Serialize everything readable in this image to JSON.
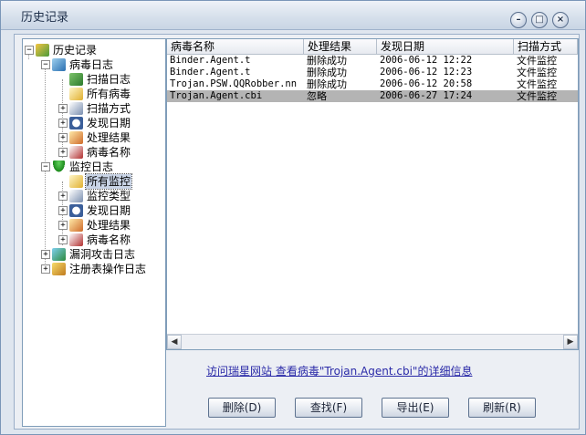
{
  "window": {
    "title": "历史记录"
  },
  "titlebar": {
    "minimize": "–",
    "maximize": "□",
    "close": "×"
  },
  "tree": {
    "root": "历史记录",
    "virus_log": "病毒日志",
    "virus_children": [
      "扫描日志",
      "所有病毒",
      "扫描方式",
      "发现日期",
      "处理结果",
      "病毒名称"
    ],
    "monitor_log": "监控日志",
    "monitor_children": [
      "所有监控",
      "监控类型",
      "发现日期",
      "处理结果",
      "病毒名称"
    ],
    "vuln_log": "漏洞攻击日志",
    "registry_log": "注册表操作日志"
  },
  "list": {
    "columns": [
      "病毒名称",
      "处理结果",
      "发现日期",
      "扫描方式"
    ],
    "rows": [
      [
        "Binder.Agent.t",
        "删除成功",
        "2006-06-12 12:22",
        "文件监控"
      ],
      [
        "Binder.Agent.t",
        "删除成功",
        "2006-06-12 12:23",
        "文件监控"
      ],
      [
        "Trojan.PSW.QQRobber.nn",
        "删除成功",
        "2006-06-12 20:58",
        "文件监控"
      ],
      [
        "Trojan.Agent.cbi",
        "忽略",
        "2006-06-27 17:24",
        "文件监控"
      ]
    ]
  },
  "links": {
    "visit": "访问瑞星网站",
    "details": "查看病毒\"Trojan.Agent.cbi\"的详细信息"
  },
  "buttons": {
    "delete": "删除(D)",
    "find": "查找(F)",
    "export": "导出(E)",
    "refresh": "刷新(R)"
  }
}
